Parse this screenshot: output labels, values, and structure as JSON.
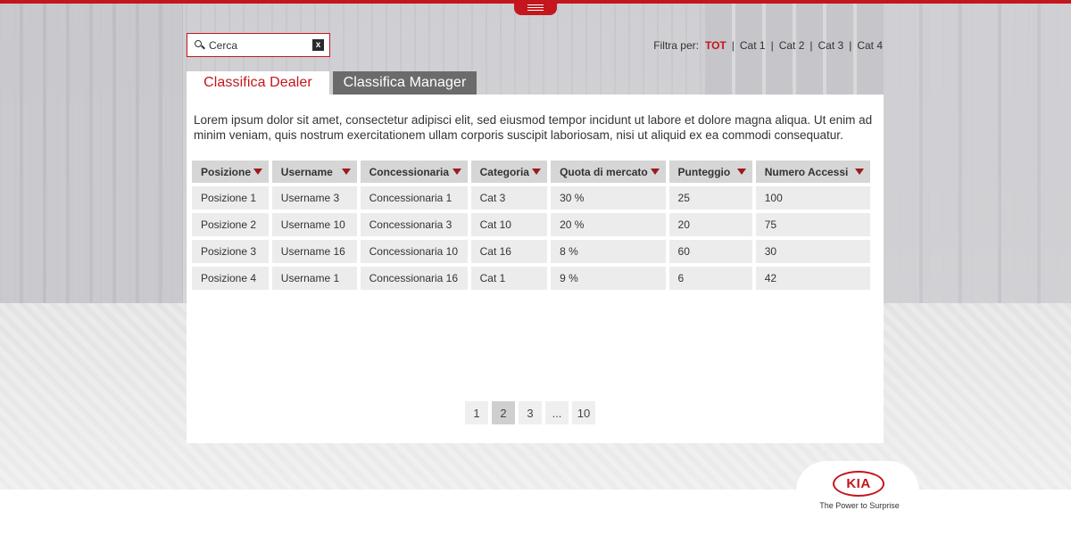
{
  "search": {
    "placeholder": "Cerca",
    "clear_label": "x"
  },
  "filters": {
    "label": "Filtra per:",
    "options": [
      "TOT",
      "Cat 1",
      "Cat 2",
      "Cat 3",
      "Cat 4"
    ],
    "active": "TOT",
    "separator": "|"
  },
  "tabs": [
    {
      "label": "Classifica Dealer",
      "active": true
    },
    {
      "label": "Classifica Manager",
      "active": false
    }
  ],
  "intro": "Lorem ipsum dolor sit amet, consectetur adipisci elit, sed eiusmod tempor incidunt ut labore et dolore magna aliqua. Ut enim ad minim veniam, quis nostrum exercitationem ullam corporis suscipit laboriosam, nisi ut aliquid ex ea commodi consequatur.",
  "table": {
    "columns": [
      "Posizione",
      "Username",
      "Concessionaria",
      "Categoria",
      "Quota di mercato",
      "Punteggio",
      "Numero Accessi"
    ],
    "rows": [
      [
        "Posizione 1",
        "Username 3",
        "Concessionaria 1",
        "Cat 3",
        "30 %",
        "25",
        "100"
      ],
      [
        "Posizione 2",
        "Username 10",
        "Concessionaria 3",
        "Cat 10",
        "20 %",
        "20",
        "75"
      ],
      [
        "Posizione 3",
        "Username 16",
        "Concessionaria 10",
        "Cat 16",
        "8 %",
        "60",
        "30"
      ],
      [
        "Posizione 4",
        "Username 1",
        "Concessionaria 16",
        "Cat 1",
        "9 %",
        "6",
        "42"
      ]
    ]
  },
  "pagination": {
    "pages": [
      "1",
      "2",
      "3",
      "...",
      "10"
    ],
    "current": "2"
  },
  "brand": {
    "logo_text": "KIA",
    "tagline": "The Power to Surprise"
  },
  "colors": {
    "accent": "#c4161c",
    "tab_inactive": "#6b6b6b"
  }
}
